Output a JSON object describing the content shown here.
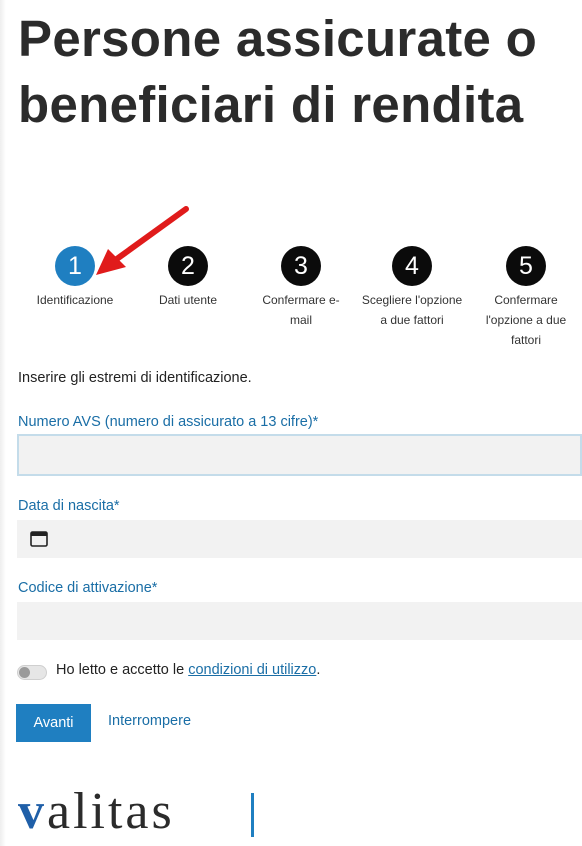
{
  "page": {
    "title": "Persone assicurate o beneficiari di rendita"
  },
  "stepper": {
    "steps": [
      {
        "number": "1",
        "label": "Identificazione",
        "active": true
      },
      {
        "number": "2",
        "label": "Dati utente",
        "active": false
      },
      {
        "number": "3",
        "label": "Confermare e-mail",
        "active": false
      },
      {
        "number": "4",
        "label": "Scegliere l'opzione a due fattori",
        "active": false
      },
      {
        "number": "5",
        "label": "Confermare l'opzione a due fattori",
        "active": false
      }
    ]
  },
  "form": {
    "intro": "Inserire gli estremi di identificazione.",
    "avs_label": "Numero AVS (numero di assicurato a 13 cifre)*",
    "avs_value": "",
    "birth_label": "Data di nascita*",
    "birth_value": "",
    "activation_label": "Codice di attivazione*",
    "activation_value": "",
    "terms_prefix": "Ho letto e accetto le ",
    "terms_link": "condizioni di utilizzo",
    "terms_suffix": ".",
    "submit_label": "Avanti",
    "cancel_label": "Interrompere"
  },
  "logo": {
    "text_first": "v",
    "text_rest": "alitas"
  },
  "icons": {
    "calendar": "calendar-icon",
    "annotation": "red-arrow-icon"
  },
  "colors": {
    "accent": "#1f7fc1",
    "link": "#1a6ea6",
    "step_inactive": "#0b0b0b",
    "annotation": "#e01b1b",
    "field_bg": "#f2f2f2"
  }
}
